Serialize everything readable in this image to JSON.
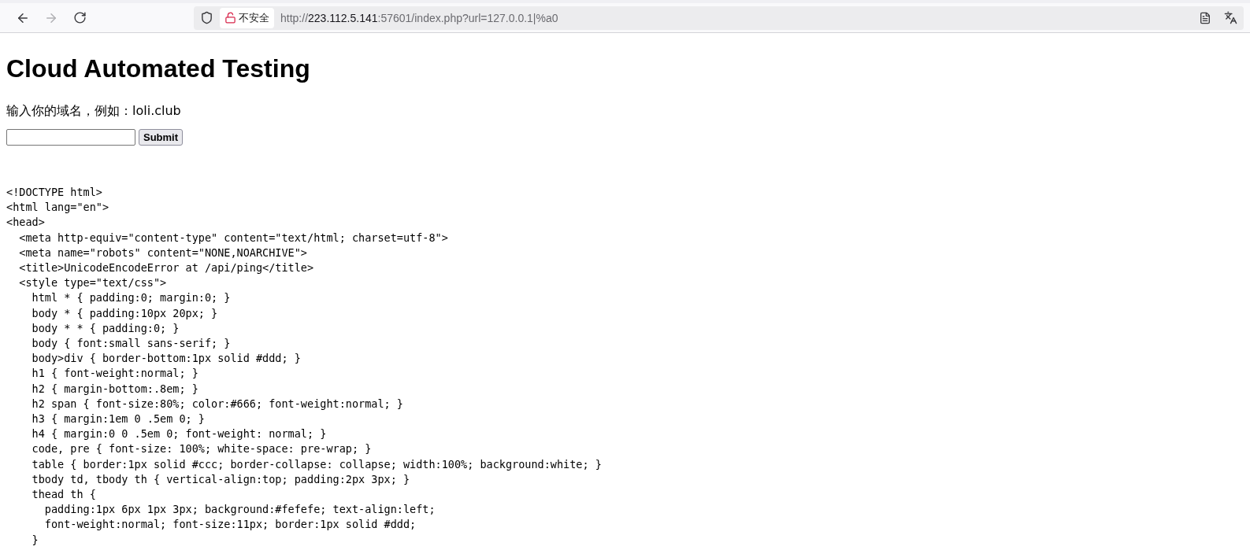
{
  "browser": {
    "security_label": "不安全",
    "url_parts": [
      {
        "text": "http://",
        "strong": false
      },
      {
        "text": "223.112.5.141",
        "strong": true
      },
      {
        "text": ":57601/index.php?url=127.0.0.1|%a0",
        "strong": false
      }
    ],
    "back_disabled": false,
    "forward_disabled": true
  },
  "page": {
    "heading": "Cloud Automated Testing",
    "prompt": "输入你的域名，例如：loli.club",
    "submit": "Submit",
    "code_lines": [
      "<!DOCTYPE html>",
      "<html lang=\"en\">",
      "<head>",
      "  <meta http-equiv=\"content-type\" content=\"text/html; charset=utf-8\">",
      "  <meta name=\"robots\" content=\"NONE,NOARCHIVE\">",
      "  <title>UnicodeEncodeError at /api/ping</title>",
      "  <style type=\"text/css\">",
      "    html * { padding:0; margin:0; }",
      "    body * { padding:10px 20px; }",
      "    body * * { padding:0; }",
      "    body { font:small sans-serif; }",
      "    body>div { border-bottom:1px solid #ddd; }",
      "    h1 { font-weight:normal; }",
      "    h2 { margin-bottom:.8em; }",
      "    h2 span { font-size:80%; color:#666; font-weight:normal; }",
      "    h3 { margin:1em 0 .5em 0; }",
      "    h4 { margin:0 0 .5em 0; font-weight: normal; }",
      "    code, pre { font-size: 100%; white-space: pre-wrap; }",
      "    table { border:1px solid #ccc; border-collapse: collapse; width:100%; background:white; }",
      "    tbody td, tbody th { vertical-align:top; padding:2px 3px; }",
      "    thead th {",
      "      padding:1px 6px 1px 3px; background:#fefefe; text-align:left;",
      "      font-weight:normal; font-size:11px; border:1px solid #ddd;",
      "    }"
    ]
  }
}
